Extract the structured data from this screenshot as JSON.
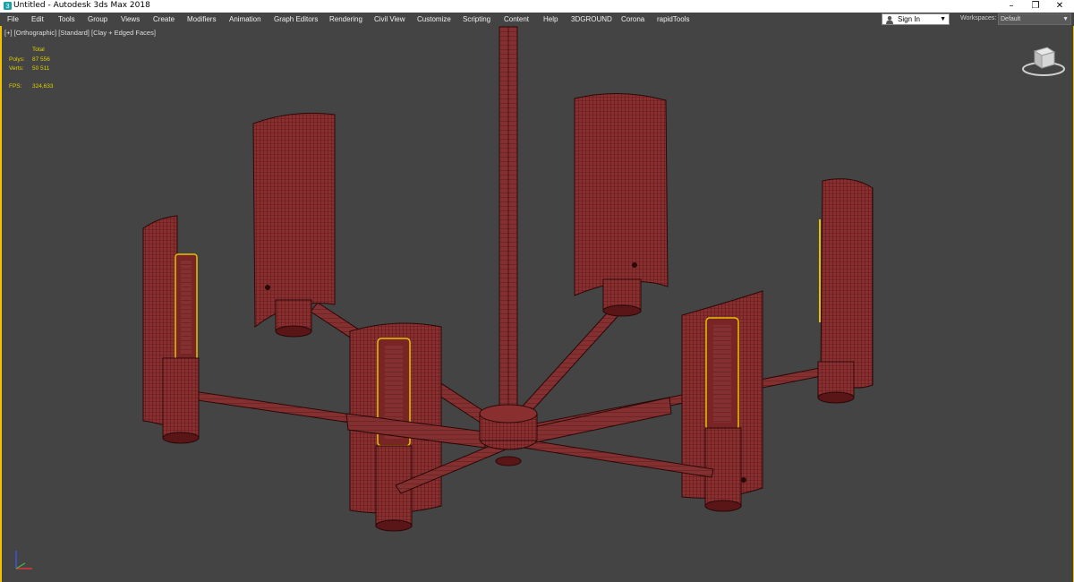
{
  "window": {
    "title": "Untitled - Autodesk 3ds Max 2018",
    "minimize": "–",
    "restore": "❐",
    "close": "✕"
  },
  "menu": {
    "items": [
      "File",
      "Edit",
      "Tools",
      "Group",
      "Views",
      "Create",
      "Modifiers",
      "Animation",
      "Graph Editors",
      "Rendering",
      "Civil View",
      "Customize",
      "Scripting",
      "Content",
      "Help",
      "3DGROUND",
      "Corona",
      "rapidTools"
    ]
  },
  "account": {
    "sign_in": "Sign In"
  },
  "workspaces": {
    "label": "Workspaces:",
    "selected": "Default"
  },
  "viewport": {
    "label_plus": "[+]",
    "label_view": "[Orthographic]",
    "label_shading_std": "[Standard]",
    "label_shading_mode": "[Clay + Edged Faces]",
    "stats": {
      "total_header": "Total",
      "polys_label": "Polys:",
      "polys_value": "87 556",
      "verts_label": "Verts:",
      "verts_value": "50 511",
      "fps_label": "FPS:",
      "fps_value": "324,633"
    }
  },
  "colors": {
    "viewport_bg": "#444444",
    "model_fill": "#8a2f2f",
    "wire": "#3b0c0c",
    "active_border": "#f2c200",
    "bulb": "#e6c200",
    "stats_text": "#e0d000"
  },
  "icons": {
    "app": "3ds-max-logo-icon",
    "user": "user-icon",
    "viewcube": "viewcube-icon",
    "axis": "axis-tripod-icon"
  }
}
